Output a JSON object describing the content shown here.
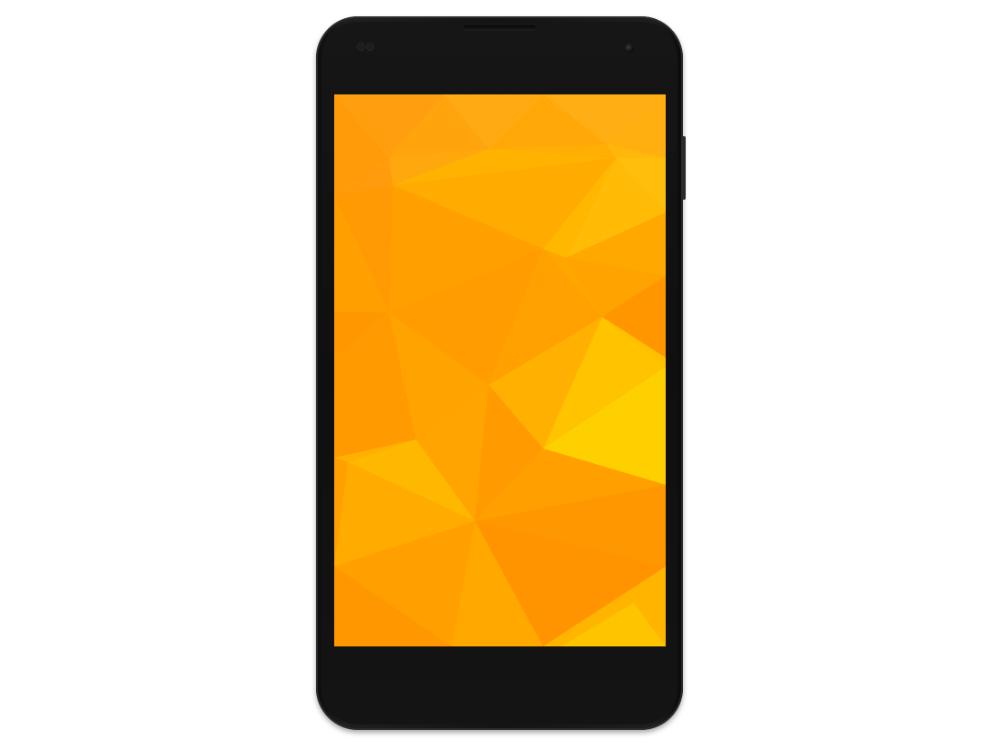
{
  "device": {
    "type": "smartphone",
    "body_color": "#141414",
    "wallpaper": {
      "style": "low-poly triangles",
      "palette": [
        "#ff9a0a",
        "#ffa800",
        "#ffb400",
        "#ffc400",
        "#ffd200",
        "#ff8f00"
      ]
    }
  }
}
